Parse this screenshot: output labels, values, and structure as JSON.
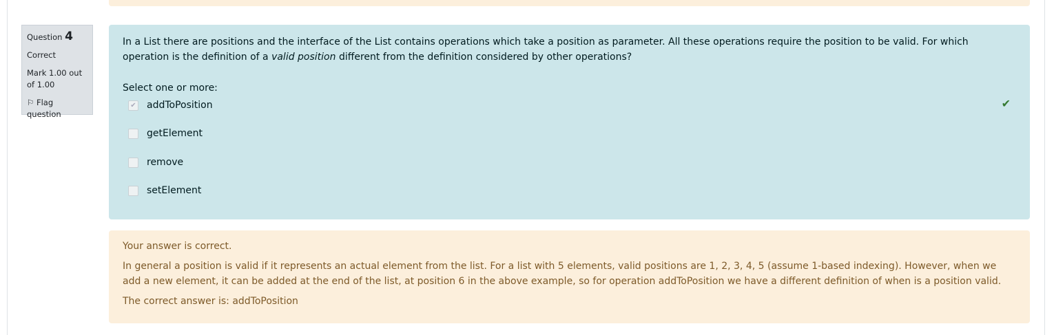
{
  "question": {
    "label": "Question",
    "number": "4",
    "state": "Correct",
    "mark": "Mark 1.00 out of 1.00",
    "flag": "Flag question"
  },
  "text": {
    "part1": "In a List there are positions and the interface of the List contains operations which take a position as parameter. All these operations require the position to be valid. For which operation is the definition of a ",
    "italic": "valid position",
    "part2": " different from the definition considered by other operations?"
  },
  "prompt": "Select one or more:",
  "options": [
    {
      "label": "addToPosition",
      "checked": true
    },
    {
      "label": "getElement",
      "checked": false
    },
    {
      "label": "remove",
      "checked": false
    },
    {
      "label": "setElement",
      "checked": false
    }
  ],
  "feedback": {
    "result": "Your answer is correct.",
    "general": "In general a position is valid if it represents an actual element from the list. For a list with 5 elements, valid positions are 1, 2, 3, 4, 5 (assume 1-based indexing). However, when we add a new element, it can be added at the end of the list, at position 6 in the above example, so for operation addToPosition we have a different definition of when is a position valid.",
    "right_answer": "The correct answer is: addToPosition"
  }
}
